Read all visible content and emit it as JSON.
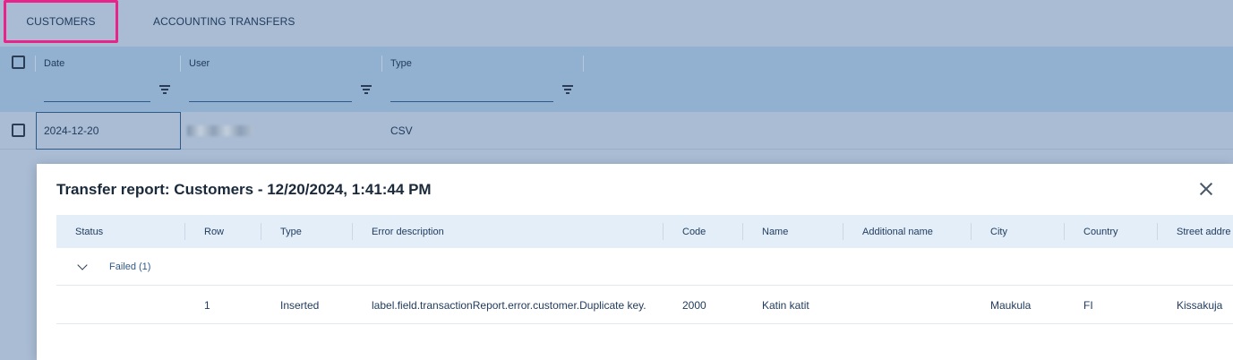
{
  "tabs": [
    {
      "label": "CUSTOMERS",
      "selected": true
    },
    {
      "label": "ACCOUNTING TRANSFERS",
      "selected": false
    }
  ],
  "grid": {
    "columns": [
      "Date",
      "User",
      "Type"
    ],
    "rows": [
      {
        "date": "2024-12-20",
        "user": "",
        "type": "CSV"
      }
    ]
  },
  "modal": {
    "title": "Transfer report: Customers - 12/20/2024, 1:41:44 PM",
    "columns": [
      "Status",
      "Row",
      "Type",
      "Error description",
      "Code",
      "Name",
      "Additional name",
      "City",
      "Country",
      "Street addre"
    ],
    "group_label": "Failed (1)",
    "rows": [
      {
        "status": "",
        "row": "1",
        "type": "Inserted",
        "error_description": "label.field.transactionReport.error.customer.Duplicate key.",
        "code": "2000",
        "name": "Katin katit",
        "additional_name": "",
        "city": "Maukula",
        "country": "FI",
        "street_address": "Kissakuja"
      }
    ]
  },
  "colors": {
    "accent_highlight": "#e8238a",
    "header_bg": "#92b0d0",
    "modal_header_bg": "#e3eef9"
  }
}
